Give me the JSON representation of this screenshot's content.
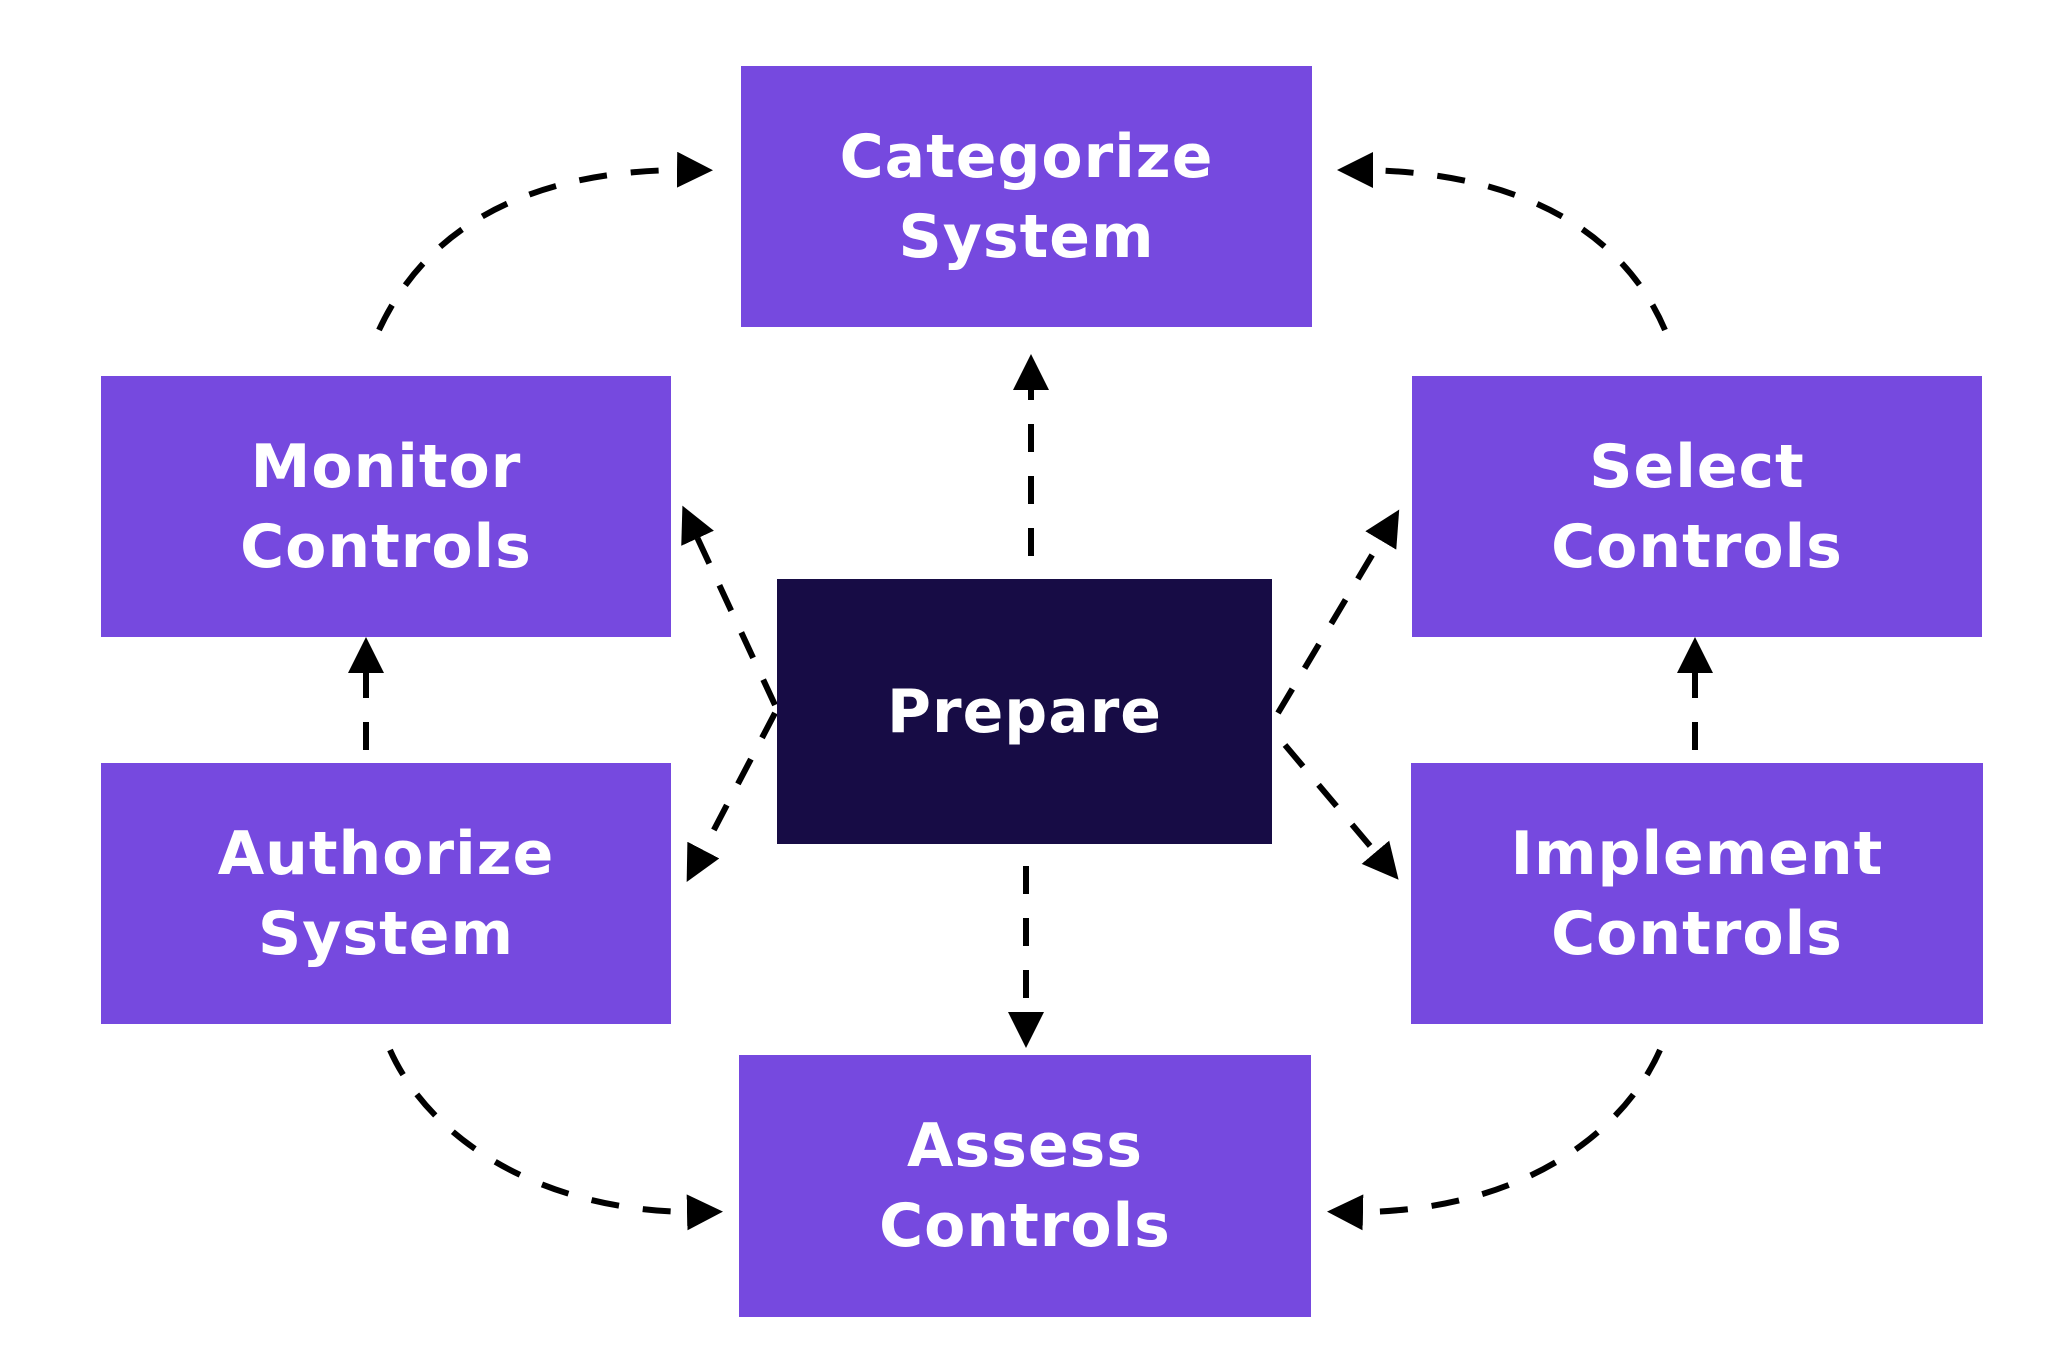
{
  "diagram": {
    "title": "",
    "colors": {
      "step_fill": "#7649df",
      "center_fill": "#170c45",
      "text": "#ffffff",
      "connector": "#000000"
    },
    "center": {
      "id": "prepare",
      "label": "Prepare"
    },
    "steps": [
      {
        "id": "categorize",
        "lines": [
          "Categorize",
          "System"
        ]
      },
      {
        "id": "select",
        "lines": [
          "Select",
          "Controls"
        ]
      },
      {
        "id": "implement",
        "lines": [
          "Implement",
          "Controls"
        ]
      },
      {
        "id": "assess",
        "lines": [
          "Assess",
          "Controls"
        ]
      },
      {
        "id": "authorize",
        "lines": [
          "Authorize",
          "System"
        ]
      },
      {
        "id": "monitor",
        "lines": [
          "Monitor",
          "Controls"
        ]
      }
    ],
    "edges": [
      {
        "from": "prepare",
        "to": "categorize",
        "style": "dashed"
      },
      {
        "from": "prepare",
        "to": "select",
        "style": "dashed"
      },
      {
        "from": "prepare",
        "to": "implement",
        "style": "dashed"
      },
      {
        "from": "prepare",
        "to": "assess",
        "style": "dashed"
      },
      {
        "from": "prepare",
        "to": "authorize",
        "style": "dashed"
      },
      {
        "from": "prepare",
        "to": "monitor",
        "style": "dashed"
      },
      {
        "from": "categorize",
        "to": "select",
        "style": "dashed-curve",
        "note": "arrow points into Categorize from Select side"
      },
      {
        "from": "implement",
        "to": "select",
        "style": "dashed"
      },
      {
        "from": "implement",
        "to": "assess",
        "style": "dashed-curve"
      },
      {
        "from": "authorize",
        "to": "assess",
        "style": "dashed-curve"
      },
      {
        "from": "authorize",
        "to": "monitor",
        "style": "dashed"
      },
      {
        "from": "monitor",
        "to": "categorize",
        "style": "dashed-curve"
      }
    ]
  }
}
